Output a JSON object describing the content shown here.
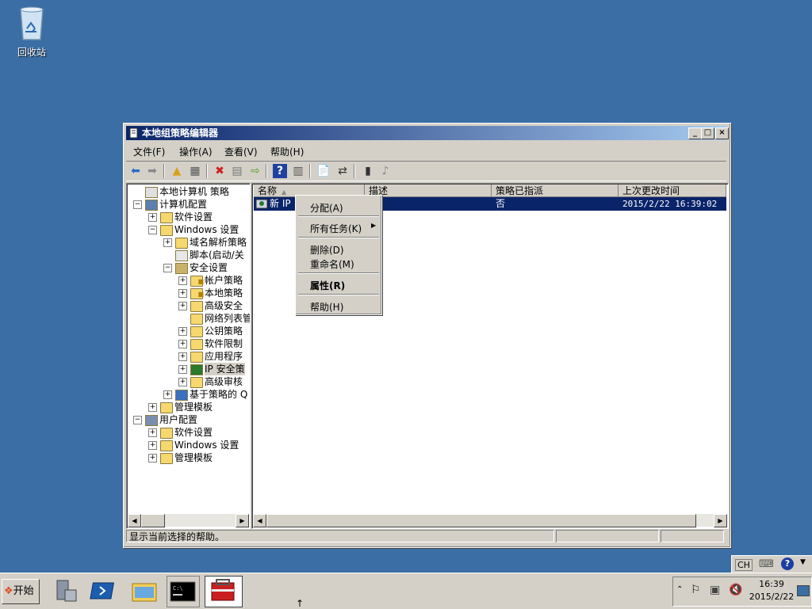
{
  "desktop": {
    "recycle_bin_label": "回收站"
  },
  "window": {
    "title": "本地组策略编辑器",
    "menu": [
      "文件(F)",
      "操作(A)",
      "查看(V)",
      "帮助(H)"
    ],
    "tree": [
      {
        "label": "本地计算机 策略",
        "icon": "policy-icon"
      },
      {
        "label": "计算机配置",
        "icon": "computer-icon"
      },
      {
        "label": "软件设置",
        "icon": "folder-icon"
      },
      {
        "label": "Windows 设置",
        "icon": "folder-icon"
      },
      {
        "label": "域名解析策略",
        "icon": "folder-icon"
      },
      {
        "label": "脚本(启动/关",
        "icon": "script-icon"
      },
      {
        "label": "安全设置",
        "icon": "security-icon"
      },
      {
        "label": "帐户策略",
        "icon": "folder-lock-icon"
      },
      {
        "label": "本地策略",
        "icon": "folder-lock-icon"
      },
      {
        "label": "高级安全",
        "icon": "folder-icon"
      },
      {
        "label": "网络列表管",
        "icon": "folder-icon"
      },
      {
        "label": "公钥策略",
        "icon": "folder-icon"
      },
      {
        "label": "软件限制",
        "icon": "folder-icon"
      },
      {
        "label": "应用程序",
        "icon": "folder-icon"
      },
      {
        "label": "IP 安全策",
        "icon": "ipsec-icon"
      },
      {
        "label": "高级审核",
        "icon": "folder-icon"
      },
      {
        "label": "基于策略的 Q",
        "icon": "chart-icon"
      },
      {
        "label": "管理模板",
        "icon": "folder-icon"
      },
      {
        "label": "用户配置",
        "icon": "user-icon"
      },
      {
        "label": "软件设置",
        "icon": "folder-icon"
      },
      {
        "label": "Windows 设置",
        "icon": "folder-icon"
      },
      {
        "label": "管理模板",
        "icon": "folder-icon"
      }
    ],
    "columns": [
      "名称",
      "描述",
      "策略已指派",
      "上次更改时间"
    ],
    "rows": [
      {
        "name": "新 IP",
        "description": "",
        "assigned": "否",
        "modified": "2015/2/22 16:39:02"
      }
    ],
    "status": "显示当前选择的帮助。"
  },
  "context_menu": {
    "items": [
      "分配(A)",
      "所有任务(K)",
      "删除(D)",
      "重命名(M)",
      "属性(R)",
      "帮助(H)"
    ]
  },
  "taskbar": {
    "start_label": "开始",
    "clock_time": "16:39",
    "clock_date": "2015/2/22",
    "lang": "CH"
  }
}
